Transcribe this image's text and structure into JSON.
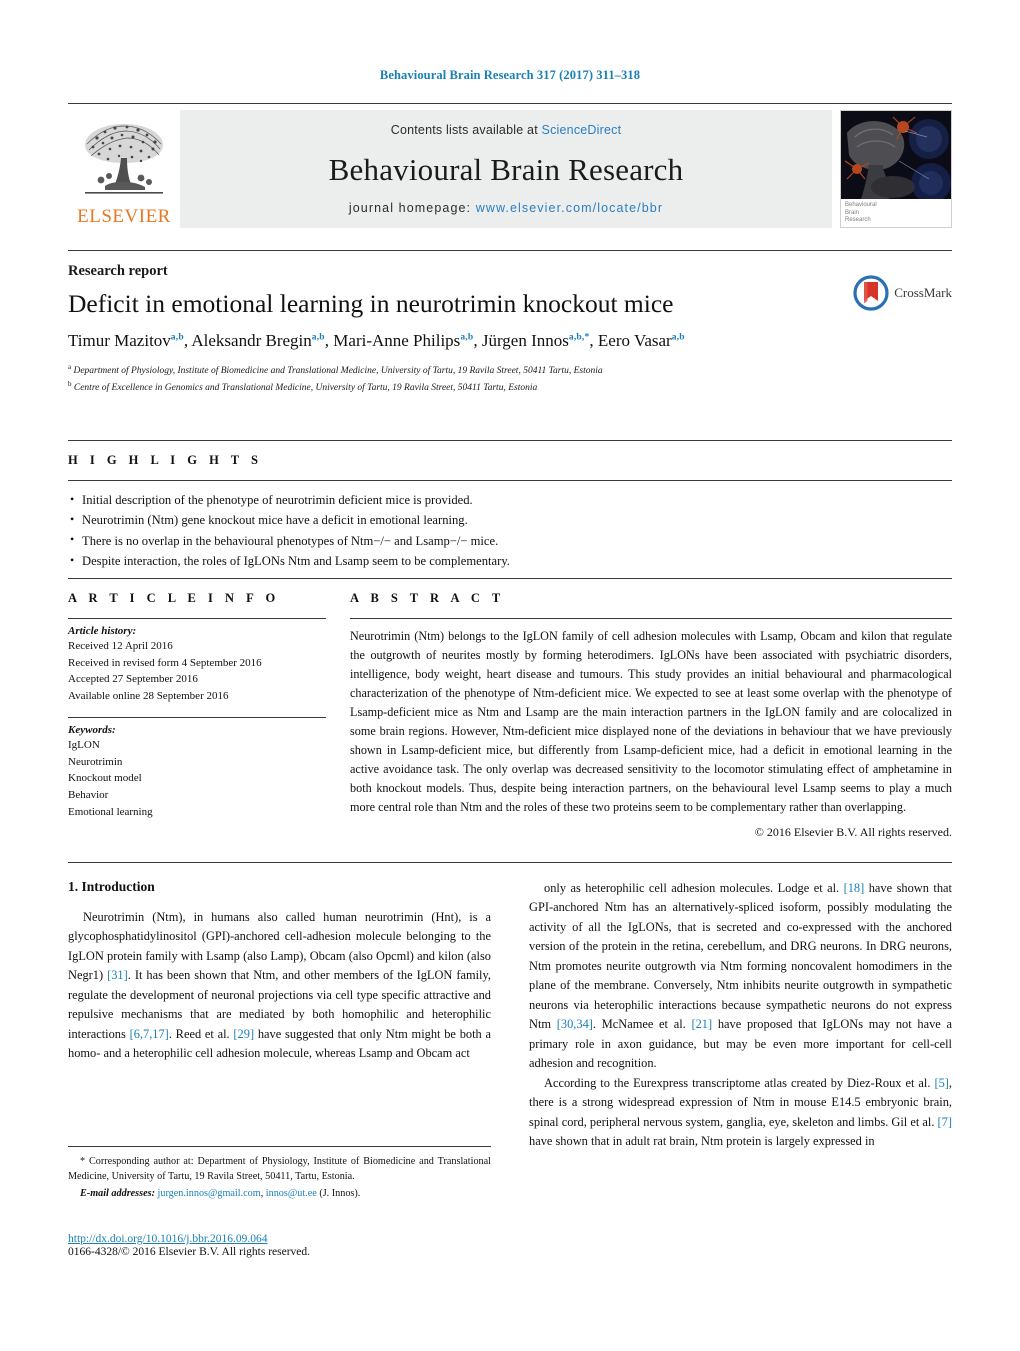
{
  "running_head": "Behavioural Brain Research 317 (2017) 311–318",
  "masthead": {
    "contents_prefix": "Contents lists available at ",
    "sciencedirect": "ScienceDirect",
    "journal_title": "Behavioural Brain Research",
    "homepage_prefix": "journal homepage: ",
    "homepage_url": "www.elsevier.com/locate/bbr",
    "publisher_wordmark": "ELSEVIER",
    "cover_caption_line1": "Behavioural",
    "cover_caption_line2": "Brain",
    "cover_caption_line3": "Research"
  },
  "article": {
    "kind": "Research report",
    "title": "Deficit in emotional learning in neurotrimin knockout mice",
    "authors_html": "Timur Mazitov<sup>a,b</sup>, Aleksandr Bregin<sup>a,b</sup>, Mari-Anne Philips<sup>a,b</sup>, Jürgen Innos<sup>a,b,</sup><sup>*</sup>, Eero Vasar<sup>a,b</sup>",
    "affiliation_a": "Department of Physiology, Institute of Biomedicine and Translational Medicine, University of Tartu, 19 Ravila Street, 50411 Tartu, Estonia",
    "affiliation_b": "Centre of Excellence in Genomics and Translational Medicine, University of Tartu, 19 Ravila Street, 50411 Tartu, Estonia",
    "crossmark_label": "CrossMark"
  },
  "highlights": {
    "label": "H I G H L I G H T S",
    "items": [
      "Initial description of the phenotype of neurotrimin deficient mice is provided.",
      "Neurotrimin (Ntm) gene knockout mice have a deficit in emotional learning.",
      "There is no overlap in the behavioural phenotypes of Ntm−/− and Lsamp−/− mice.",
      "Despite interaction, the roles of IgLONs Ntm and Lsamp seem to be complementary."
    ]
  },
  "article_info": {
    "label": "A R T I C L E    I N F O",
    "history_heading": "Article history:",
    "history": [
      "Received 12 April 2016",
      "Received in revised form 4 September 2016",
      "Accepted 27 September 2016",
      "Available online 28 September 2016"
    ],
    "keywords_heading": "Keywords:",
    "keywords": [
      "IgLON",
      "Neurotrimin",
      "Knockout model",
      "Behavior",
      "Emotional learning"
    ]
  },
  "abstract": {
    "label": "A B S T R A C T",
    "text": "Neurotrimin (Ntm) belongs to the IgLON family of cell adhesion molecules with Lsamp, Obcam and kilon that regulate the outgrowth of neurites mostly by forming heterodimers. IgLONs have been associated with psychiatric disorders, intelligence, body weight, heart disease and tumours. This study provides an initial behavioural and pharmacological characterization of the phenotype of Ntm-deficient mice. We expected to see at least some overlap with the phenotype of Lsamp-deficient mice as Ntm and Lsamp are the main interaction partners in the IgLON family and are colocalized in some brain regions. However, Ntm-deficient mice displayed none of the deviations in behaviour that we have previously shown in Lsamp-deficient mice, but differently from Lsamp-deficient mice, had a deficit in emotional learning in the active avoidance task. The only overlap was decreased sensitivity to the locomotor stimulating effect of amphetamine in both knockout models. Thus, despite being interaction partners, on the behavioural level Lsamp seems to play a much more central role than Ntm and the roles of these two proteins seem to be complementary rather than overlapping.",
    "copyright": "© 2016 Elsevier B.V. All rights reserved."
  },
  "body": {
    "section_number_title": "1.  Introduction",
    "left_paragraph_html": "Neurotrimin (Ntm), in humans also called human neurotrimin (Hnt), is a glycophosphatidylinositol (GPI)-anchored cell-adhesion molecule belonging to the IgLON protein family with Lsamp (also Lamp), Obcam (also Opcml) and kilon (also Negr1) <span class=\"ref\">[31]</span>. It has been shown that Ntm, and other members of the IgLON family, regulate the development of neuronal projections via cell type specific attractive and repulsive mechanisms that are mediated by both homophilic and heterophilic interactions <span class=\"ref\">[6,7,17]</span>. Reed et al. <span class=\"ref\">[29]</span> have suggested that only Ntm might be both a homo- and a heterophilic cell adhesion molecule, whereas Lsamp and Obcam act",
    "right_paragraph_1_html": "only as heterophilic cell adhesion molecules. Lodge et al. <span class=\"ref\">[18]</span> have shown that GPI-anchored Ntm has an alternatively-spliced isoform, possibly modulating the activity of all the IgLONs, that is secreted and co-expressed with the anchored version of the protein in the retina, cerebellum, and DRG neurons. In DRG neurons, Ntm promotes neurite outgrowth via Ntm forming noncovalent homodimers in the plane of the membrane. Conversely, Ntm inhibits neurite outgrowth in sympathetic neurons via heterophilic interactions because sympathetic neurons do not express Ntm <span class=\"ref\">[30,34]</span>. McNamee et al. <span class=\"ref\">[21]</span> have proposed that IgLONs may not have a primary role in axon guidance, but may be even more important for cell-cell adhesion and recognition.",
    "right_paragraph_2_html": "According to the Eurexpress transcriptome atlas created by Diez-Roux et al. <span class=\"ref\">[5]</span>, there is a strong widespread expression of Ntm in mouse E14.5 embryonic brain, spinal cord, peripheral nervous system, ganglia, eye, skeleton and limbs. Gil et al. <span class=\"ref\">[7]</span> have shown that in adult rat brain, Ntm protein is largely expressed in"
  },
  "footnote": {
    "corresponding_html": "* Corresponding author at: Department of Physiology, Institute of Biomedicine and Translational Medicine, University of Tartu, 19 Ravila Street, 50411, Tartu, Estonia.",
    "email_label": "E-mail addresses:",
    "email_1": "jurgen.innos@gmail.com",
    "email_2": "innos@ut.ee",
    "email_suffix": "(J. Innos).",
    "doi_url": "http://dx.doi.org/10.1016/j.bbr.2016.09.064",
    "issn_line": "0166-4328/© 2016 Elsevier B.V. All rights reserved."
  },
  "colors": {
    "link_blue": "#1a7fb5",
    "elsevier_orange": "#e87722",
    "masthead_grey": "#eceded"
  }
}
